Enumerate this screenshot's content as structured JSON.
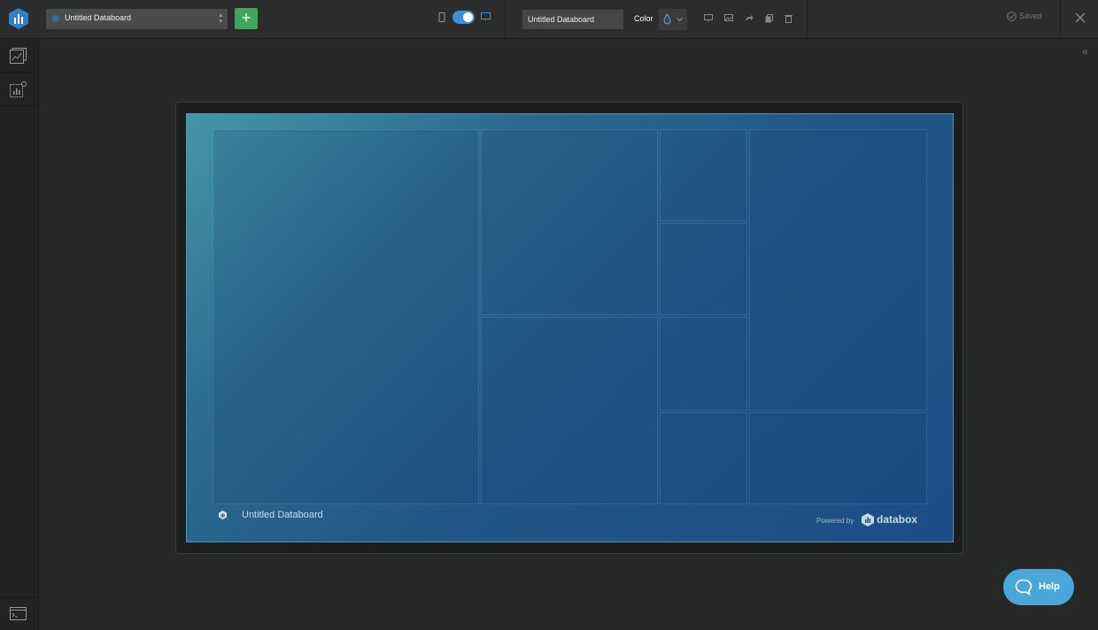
{
  "header": {
    "board_name": "Untitled Databoard",
    "add_label": "+",
    "name_input_value": "Untitled Databoard",
    "color_label": "Color",
    "status": "Saved"
  },
  "board": {
    "footer_title": "Untitled Databoard",
    "powered_by": "Powered by",
    "brand": "databox"
  },
  "help": {
    "label": "Help"
  },
  "colors": {
    "accent": "#3d8fd6",
    "add_button": "#3fa55d",
    "help_button": "#4aa8d8",
    "board_gradient_start": "#4596a6",
    "board_gradient_end": "#1c4d85"
  },
  "icons": [
    "databox-logo-icon",
    "phone-icon",
    "desktop-icon",
    "color-drop-icon",
    "chevron-down-icon",
    "monitor-icon",
    "image-icon",
    "share-icon",
    "copy-icon",
    "trash-icon",
    "check-circle-icon",
    "close-icon",
    "dashboard-icon",
    "add-metric-icon",
    "terminal-icon",
    "collapse-icon",
    "chat-icon"
  ]
}
